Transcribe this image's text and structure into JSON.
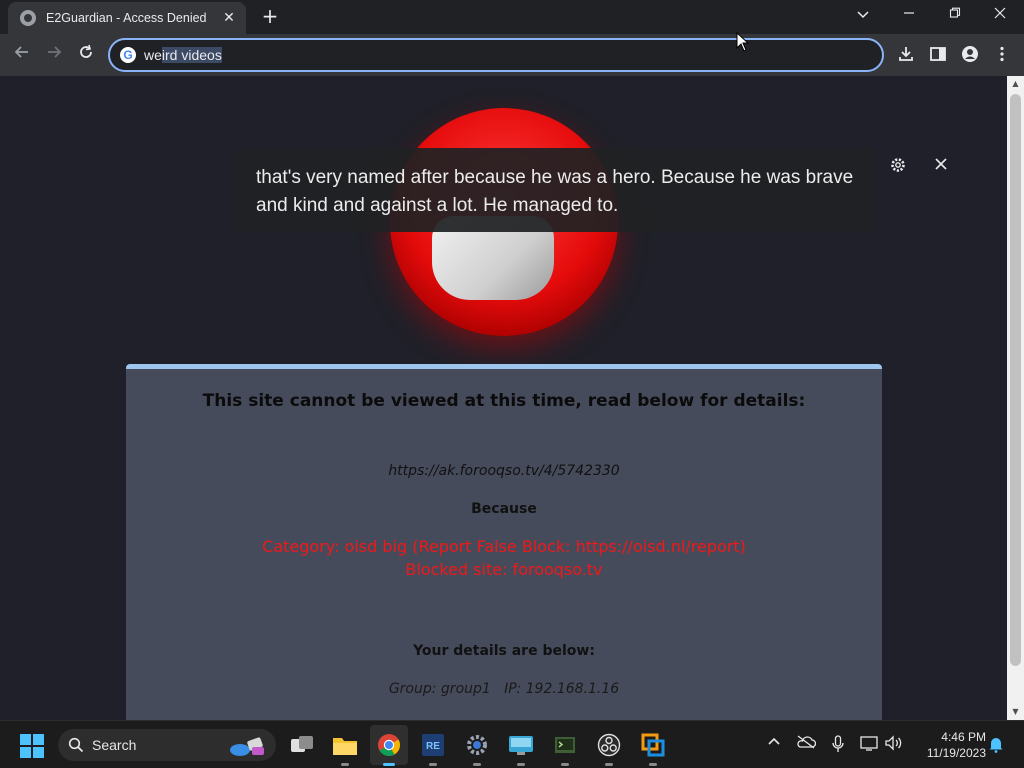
{
  "browser": {
    "tab_title": "E2Guardian - Access Denied",
    "address_text_before": "we",
    "address_text_selected": "ird videos"
  },
  "page": {
    "heading": "This site cannot be viewed at this time, read below for details:",
    "blocked_url": "https://ak.forooqso.tv/4/5742330",
    "because_label": "Because",
    "category_line": "Category: oisd big (Report False Block: https://oisd.nl/report)",
    "blocked_site_line": "Blocked site: forooqso.tv",
    "details_heading": "Your details are below:",
    "group_line": "Group: group1   IP: 192.168.1.16"
  },
  "live_caption": {
    "text": "that's very named after because he was a hero. Because he was brave and kind and against a lot. He managed to."
  },
  "taskbar": {
    "search_label": "Search",
    "time": "4:46 PM",
    "date": "11/19/2023",
    "apps": [
      "task-view",
      "file-explorer",
      "chrome",
      "re-app",
      "settings",
      "screen-app",
      "terminal-app",
      "obs",
      "vmware"
    ]
  },
  "colors": {
    "accent": "#8ab4f8",
    "blocked_red": "#f01818",
    "card_bg": "#464b5b",
    "page_bg": "#1f2029"
  }
}
